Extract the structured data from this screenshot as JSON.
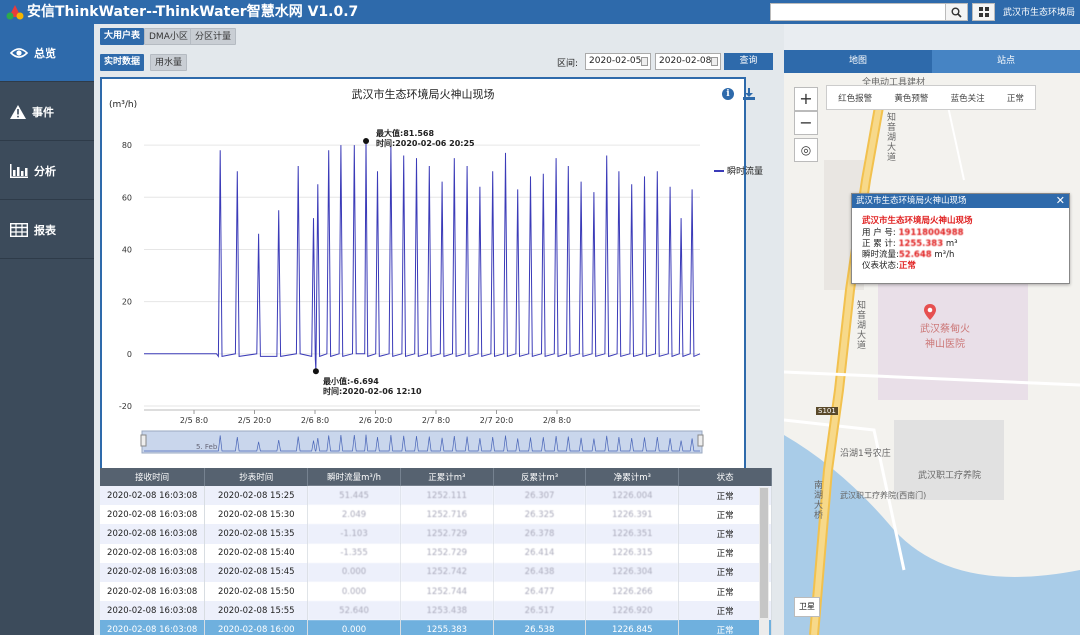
{
  "header": {
    "app_title": "安信ThinkWater--ThinkWater智慧水网  V1.0.7",
    "org_name": "武汉市生态环境局",
    "search_placeholder": ""
  },
  "sidebar": {
    "items": [
      {
        "label": "总览",
        "icon": "eye-icon",
        "active": true
      },
      {
        "label": "事件",
        "icon": "warning-icon",
        "active": false
      },
      {
        "label": "分析",
        "icon": "bar-chart-icon",
        "active": false
      },
      {
        "label": "报表",
        "icon": "table-icon",
        "active": false
      }
    ]
  },
  "toolbar": {
    "category_tabs": [
      "大用户表",
      "DMA小区",
      "分区计量"
    ],
    "mode_tabs": [
      "实时数据",
      "用水量"
    ],
    "range_label": "区间:",
    "start_date": "2020-02-05",
    "end_date": "2020-02-08",
    "query_label": "查询"
  },
  "chart": {
    "title": "武汉市生态环境局火神山现场",
    "ylabel": "(m³/h)",
    "legend": "瞬时流量",
    "max_label": "最大值:81.568",
    "max_time": "时间:2020-02-06 20:25",
    "min_label": "最小值:-6.694",
    "min_time": "时间:2020-02-06 12:10",
    "navigator_label": "5. Feb"
  },
  "chart_data": {
    "type": "line",
    "title": "武汉市生态环境局火神山现场",
    "ylabel": "(m³/h)",
    "ylim": [
      -20,
      90
    ],
    "yticks": [
      -20,
      0,
      20,
      40,
      60,
      80
    ],
    "xticks": [
      "2/5 8:0",
      "2/5 20:0",
      "2/6 8:0",
      "2/6 20:0",
      "2/7 8:0",
      "2/7 20:0",
      "2/8 8:0"
    ],
    "series": [
      {
        "name": "瞬时流量",
        "color": "#3b3bb8",
        "points": [
          {
            "t": 0,
            "v": 0
          },
          {
            "t": 11.9,
            "v": 0
          },
          {
            "t": 12.2,
            "v": -1
          },
          {
            "t": 12.5,
            "v": 78
          },
          {
            "t": 12.8,
            "v": -1
          },
          {
            "t": 15.0,
            "v": 0
          },
          {
            "t": 15.3,
            "v": 70
          },
          {
            "t": 15.6,
            "v": -1
          },
          {
            "t": 18.5,
            "v": 0
          },
          {
            "t": 18.8,
            "v": 46
          },
          {
            "t": 19.1,
            "v": -1
          },
          {
            "t": 21.8,
            "v": -1
          },
          {
            "t": 22.1,
            "v": 55
          },
          {
            "t": 22.4,
            "v": -1
          },
          {
            "t": 25.0,
            "v": 0
          },
          {
            "t": 25.3,
            "v": 72
          },
          {
            "t": 25.6,
            "v": 0
          },
          {
            "t": 27.5,
            "v": -1
          },
          {
            "t": 27.8,
            "v": 52
          },
          {
            "t": 28.1,
            "v": -2
          },
          {
            "t": 28.2,
            "v": -6.694
          },
          {
            "t": 28.5,
            "v": 65
          },
          {
            "t": 28.8,
            "v": -1
          },
          {
            "t": 30.0,
            "v": 0
          },
          {
            "t": 30.3,
            "v": 78
          },
          {
            "t": 30.6,
            "v": -1
          },
          {
            "t": 32.0,
            "v": 0
          },
          {
            "t": 32.3,
            "v": 80
          },
          {
            "t": 32.6,
            "v": -1
          },
          {
            "t": 34.2,
            "v": 0
          },
          {
            "t": 34.5,
            "v": 80
          },
          {
            "t": 34.8,
            "v": 0
          },
          {
            "t": 36.2,
            "v": 0
          },
          {
            "t": 36.42,
            "v": 81.568
          },
          {
            "t": 36.7,
            "v": -1
          },
          {
            "t": 38.0,
            "v": 0
          },
          {
            "t": 38.3,
            "v": 70
          },
          {
            "t": 38.6,
            "v": -1
          },
          {
            "t": 40.2,
            "v": 0
          },
          {
            "t": 40.5,
            "v": 80
          },
          {
            "t": 40.8,
            "v": -1
          },
          {
            "t": 42.3,
            "v": 0
          },
          {
            "t": 42.6,
            "v": 76
          },
          {
            "t": 42.9,
            "v": -1
          },
          {
            "t": 44.4,
            "v": 0
          },
          {
            "t": 44.7,
            "v": 75
          },
          {
            "t": 45.0,
            "v": -1
          },
          {
            "t": 46.5,
            "v": 0
          },
          {
            "t": 46.8,
            "v": 72
          },
          {
            "t": 47.1,
            "v": -1
          },
          {
            "t": 48.6,
            "v": 0
          },
          {
            "t": 48.9,
            "v": 66
          },
          {
            "t": 49.2,
            "v": -1
          },
          {
            "t": 50.6,
            "v": 0
          },
          {
            "t": 50.9,
            "v": 75
          },
          {
            "t": 51.2,
            "v": -1
          },
          {
            "t": 52.7,
            "v": 0
          },
          {
            "t": 53.0,
            "v": 72
          },
          {
            "t": 53.3,
            "v": -1
          },
          {
            "t": 54.8,
            "v": 0
          },
          {
            "t": 55.1,
            "v": 64
          },
          {
            "t": 55.4,
            "v": -1
          },
          {
            "t": 56.9,
            "v": 0
          },
          {
            "t": 57.2,
            "v": 70
          },
          {
            "t": 57.5,
            "v": -1
          },
          {
            "t": 59.0,
            "v": 0
          },
          {
            "t": 59.3,
            "v": 77
          },
          {
            "t": 59.6,
            "v": -1
          },
          {
            "t": 61.0,
            "v": 0
          },
          {
            "t": 61.3,
            "v": 63
          },
          {
            "t": 61.6,
            "v": -1
          },
          {
            "t": 63.1,
            "v": 0
          },
          {
            "t": 63.4,
            "v": 68
          },
          {
            "t": 63.7,
            "v": -1
          },
          {
            "t": 65.2,
            "v": 0
          },
          {
            "t": 65.5,
            "v": 69
          },
          {
            "t": 65.8,
            "v": -1
          },
          {
            "t": 67.3,
            "v": 0
          },
          {
            "t": 67.6,
            "v": 75
          },
          {
            "t": 67.9,
            "v": -1
          },
          {
            "t": 69.3,
            "v": 0
          },
          {
            "t": 69.6,
            "v": 72
          },
          {
            "t": 69.9,
            "v": -1
          },
          {
            "t": 71.4,
            "v": 0
          },
          {
            "t": 71.7,
            "v": 66
          },
          {
            "t": 72.0,
            "v": -1
          },
          {
            "t": 73.5,
            "v": 0
          },
          {
            "t": 73.8,
            "v": 62
          },
          {
            "t": 74.1,
            "v": -1
          },
          {
            "t": 75.6,
            "v": 0
          },
          {
            "t": 75.9,
            "v": 76
          },
          {
            "t": 76.2,
            "v": -1
          },
          {
            "t": 77.6,
            "v": 0
          },
          {
            "t": 77.9,
            "v": 70
          },
          {
            "t": 78.2,
            "v": -1
          },
          {
            "t": 79.7,
            "v": 0
          },
          {
            "t": 80.0,
            "v": 65
          },
          {
            "t": 80.3,
            "v": -1
          },
          {
            "t": 81.8,
            "v": 0
          },
          {
            "t": 82.1,
            "v": 68
          },
          {
            "t": 82.4,
            "v": -1
          },
          {
            "t": 83.9,
            "v": 0
          },
          {
            "t": 84.2,
            "v": 70
          },
          {
            "t": 84.5,
            "v": -1
          },
          {
            "t": 86.0,
            "v": 0
          },
          {
            "t": 86.3,
            "v": 64
          },
          {
            "t": 86.6,
            "v": -1
          },
          {
            "t": 87.8,
            "v": 0
          },
          {
            "t": 88.1,
            "v": 52
          },
          {
            "t": 88.4,
            "v": -1
          },
          {
            "t": 89.6,
            "v": 0
          },
          {
            "t": 89.9,
            "v": 63
          },
          {
            "t": 90.2,
            "v": -1
          },
          {
            "t": 91.2,
            "v": 0
          }
        ]
      }
    ]
  },
  "table": {
    "headers": [
      "接收时间",
      "抄表时间",
      "瞬时流量m³/h",
      "正累计m³",
      "反累计m³",
      "净累计m³",
      "状态"
    ],
    "rows": [
      [
        "2020-02-08 16:03:08",
        "2020-02-08 15:25",
        "51.445",
        "1252.111",
        "26.307",
        "1226.004",
        "正常"
      ],
      [
        "2020-02-08 16:03:08",
        "2020-02-08 15:30",
        "2.049",
        "1252.716",
        "26.325",
        "1226.391",
        "正常"
      ],
      [
        "2020-02-08 16:03:08",
        "2020-02-08 15:35",
        "-1.103",
        "1252.729",
        "26.378",
        "1226.351",
        "正常"
      ],
      [
        "2020-02-08 16:03:08",
        "2020-02-08 15:40",
        "-1.355",
        "1252.729",
        "26.414",
        "1226.315",
        "正常"
      ],
      [
        "2020-02-08 16:03:08",
        "2020-02-08 15:45",
        "0.000",
        "1252.742",
        "26.438",
        "1226.304",
        "正常"
      ],
      [
        "2020-02-08 16:03:08",
        "2020-02-08 15:50",
        "0.000",
        "1252.744",
        "26.477",
        "1226.266",
        "正常"
      ],
      [
        "2020-02-08 16:03:08",
        "2020-02-08 15:55",
        "52.640",
        "1253.438",
        "26.517",
        "1226.920",
        "正常"
      ],
      [
        "2020-02-08 16:03:08",
        "2020-02-08 16:00",
        "0.000",
        "1255.383",
        "26.538",
        "1226.845",
        "正常"
      ]
    ]
  },
  "map": {
    "tabs": [
      "地图",
      "站点"
    ],
    "filters": [
      "红色报警",
      "黄色预警",
      "蓝色关注",
      "正常"
    ],
    "labels": [
      "全电动工具建材",
      "知音湖大道",
      "知音湖大道",
      "武汉蔡甸火神山医院",
      "沿湖1号农庄",
      "武汉职工疗养院",
      "武汉职工疗养院(西南门)",
      "南湖大桥",
      "S101"
    ],
    "satellite_label": "卫星",
    "popup": {
      "header": "武汉市生态环境局火神山现场",
      "name": "武汉市生态环境局火神山现场",
      "user_label": "用 户 号:",
      "user_value": "19118004988",
      "total_label": "正 累 计:",
      "total_value": "1255.383",
      "total_unit": "m³",
      "flow_label": "瞬时流量:",
      "flow_value": "52.648",
      "flow_unit": "m³/h",
      "status_label": "仪表状态:",
      "status_value": "正常"
    }
  },
  "colors": {
    "primary": "#2e6aab",
    "sidebar": "#3c4b5b",
    "series": "#3b3bb8",
    "alert": "#e02020"
  }
}
